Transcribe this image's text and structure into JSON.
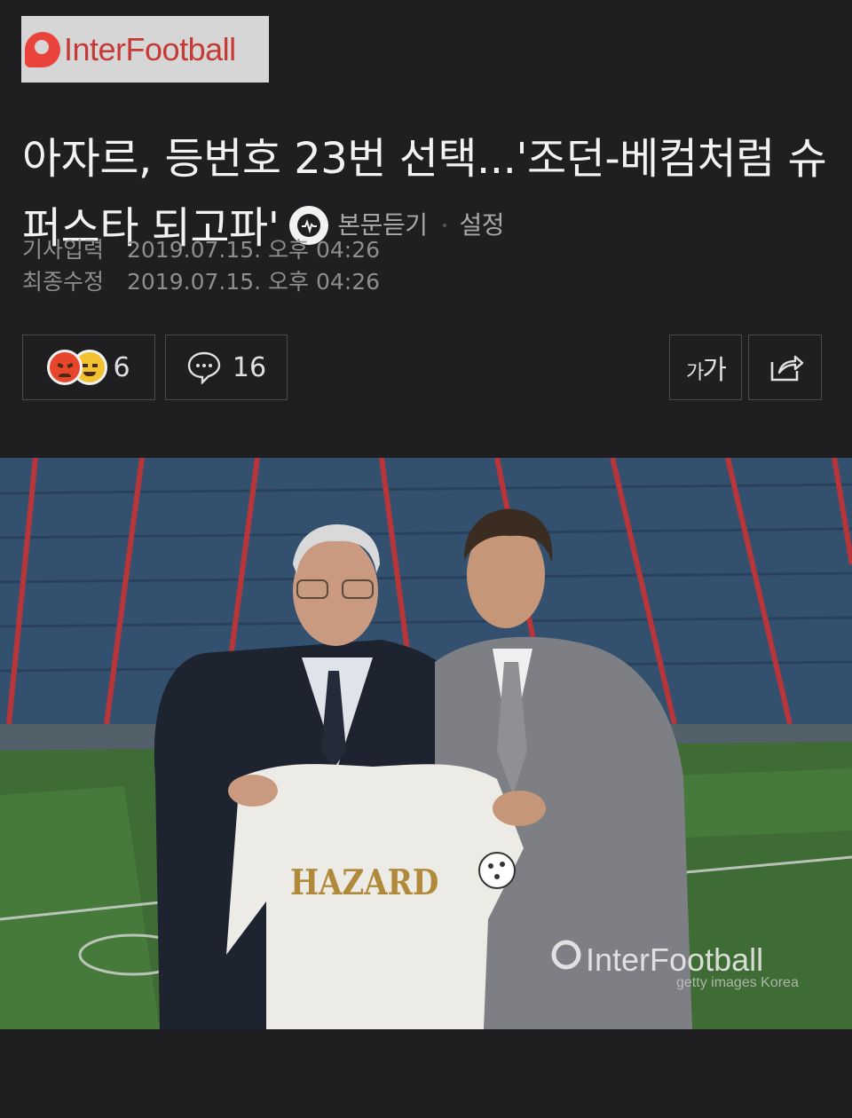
{
  "brand": {
    "name": "InterFootball"
  },
  "article": {
    "title": "아자르, 등번호 23번 선택...'조던-베컴처럼 슈퍼스타 되고파'",
    "listen_label": "본문듣기",
    "settings_label": "설정",
    "published_label": "기사입력",
    "published_value": "2019.07.15. 오후 04:26",
    "modified_label": "최종수정",
    "modified_value": "2019.07.15. 오후 04:26"
  },
  "toolbar": {
    "reaction_count": "6",
    "comment_count": "16",
    "font_size_small": "가",
    "font_size_large": "가"
  },
  "photo": {
    "jersey_text": "HAZARD",
    "watermark": "InterFootball",
    "credit": "getty images Korea"
  },
  "colors": {
    "background": "#1f1f21",
    "brand_red": "#e9433c",
    "border": "#4a4a4c"
  }
}
